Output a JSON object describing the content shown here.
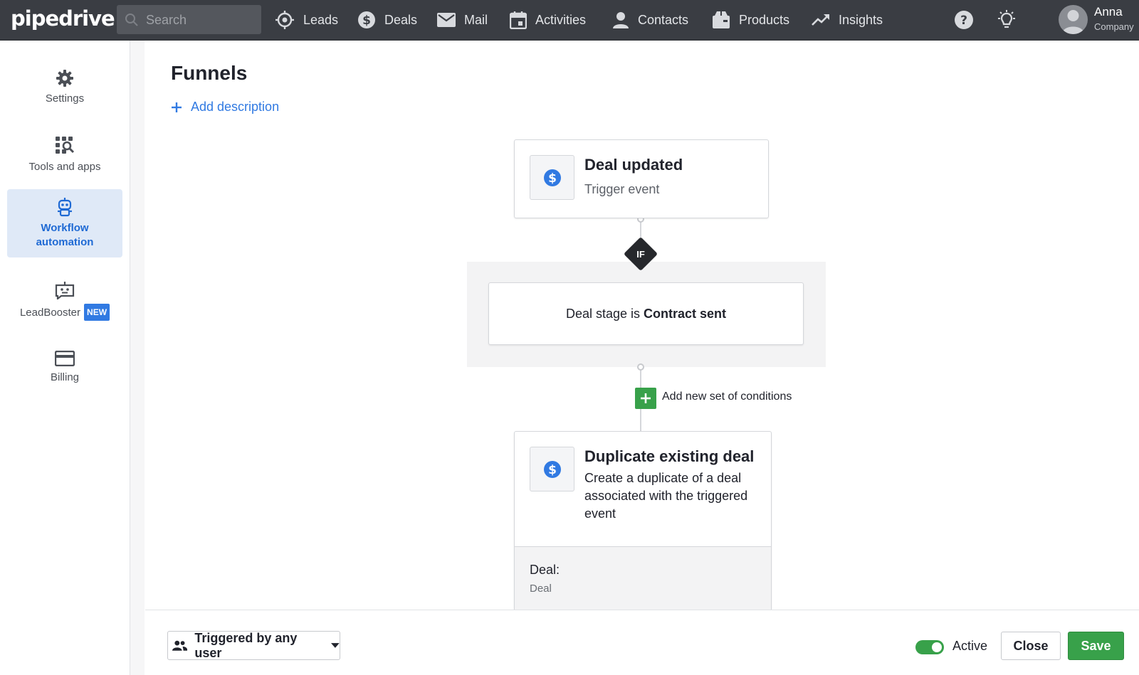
{
  "app": {
    "logo": "pipedrive"
  },
  "topnav": {
    "search_placeholder": "Search",
    "items": [
      {
        "label": "Leads",
        "icon": "target-icon"
      },
      {
        "label": "Deals",
        "icon": "dollar-icon"
      },
      {
        "label": "Mail",
        "icon": "mail-icon"
      },
      {
        "label": "Activities",
        "icon": "calendar-icon"
      },
      {
        "label": "Contacts",
        "icon": "person-icon"
      },
      {
        "label": "Products",
        "icon": "box-icon"
      },
      {
        "label": "Insights",
        "icon": "trend-icon"
      }
    ],
    "user": {
      "name": "Anna",
      "company": "Company"
    }
  },
  "sidebar": {
    "items": [
      {
        "label": "Settings",
        "icon": "gear-icon"
      },
      {
        "label": "Tools and apps",
        "icon": "tools-icon"
      },
      {
        "label": "Workflow automation",
        "icon": "robot-icon",
        "active": true
      },
      {
        "label": "LeadBooster",
        "icon": "chatbot-icon",
        "badge": "NEW"
      },
      {
        "label": "Billing",
        "icon": "credit-card-icon"
      }
    ]
  },
  "main": {
    "title": "Funnels",
    "add_description": "Add description",
    "trigger": {
      "title": "Deal updated",
      "subtitle": "Trigger event"
    },
    "if_label": "IF",
    "condition": {
      "prefix": "Deal stage is",
      "value": "Contract sent"
    },
    "add_conditions": "Add new set of conditions",
    "action": {
      "title": "Duplicate existing deal",
      "description": "Create a duplicate of a deal associated with the triggered event",
      "field_label": "Deal:",
      "field_value": "Deal"
    }
  },
  "footer": {
    "trigger_select": "Triggered by any user",
    "active_label": "Active",
    "active": true,
    "close": "Close",
    "save": "Save"
  },
  "colors": {
    "accent": "#317ae2",
    "success": "#38a14a",
    "topbar": "#3a3d43"
  }
}
